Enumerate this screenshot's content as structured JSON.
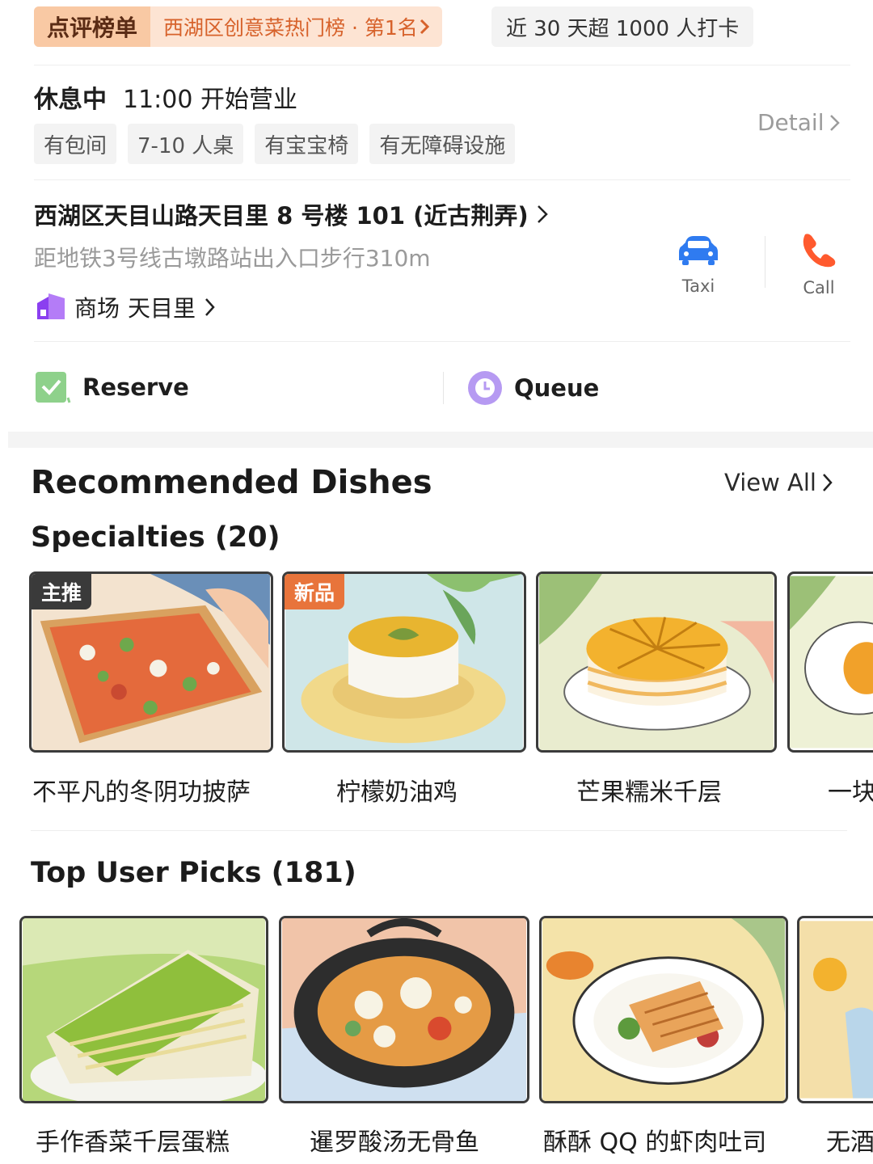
{
  "ranking": {
    "title": "点评榜单",
    "text": "西湖区创意菜热门榜 · 第1名",
    "checkin": "近 30 天超 1000 人打卡"
  },
  "hours": {
    "status": "休息中",
    "open_text": "11:00 开始营业"
  },
  "facilities": [
    "有包间",
    "7-10 人桌",
    "有宝宝椅",
    "有无障碍设施"
  ],
  "detail_label": "Detail",
  "location": {
    "address": "西湖区天目山路天目里 8 号楼 101 (近古荆弄)",
    "metro": "距地铁3号线古墩路站出入口步行310m",
    "mall_label": "商场",
    "mall_name": "天目里"
  },
  "quick_actions": {
    "taxi": "Taxi",
    "call": "Call"
  },
  "reserve_label": "Reserve",
  "queue_label": "Queue",
  "dishes_section": {
    "title": "Recommended Dishes",
    "view_all": "View All",
    "specialties": {
      "title": "Specialties (20)",
      "items": [
        {
          "badge": "主推",
          "name": "不平凡的冬阴功披萨"
        },
        {
          "badge": "新品",
          "name": "柠檬奶油鸡"
        },
        {
          "name": "芒果糯米千层"
        },
        {
          "name": "一块"
        }
      ]
    },
    "top_picks": {
      "title": "Top User Picks (181)",
      "items": [
        {
          "name": "手作香菜千层蛋糕"
        },
        {
          "name": "暹罗酸汤无骨鱼"
        },
        {
          "name": "酥酥 QQ 的虾肉吐司"
        },
        {
          "name": "无酒"
        }
      ]
    }
  },
  "colors": {
    "accent_orange": "#d7622b",
    "taxi_blue": "#2f7bf0",
    "call_orange": "#ff5a2e",
    "reserve_green": "#8ed18b",
    "queue_purple": "#b69af2",
    "mall_purple": "#8b3ff0"
  },
  "icons": [
    "chevron-right-icon",
    "taxi-icon",
    "phone-icon",
    "check-icon",
    "clock-icon",
    "mall-icon"
  ]
}
